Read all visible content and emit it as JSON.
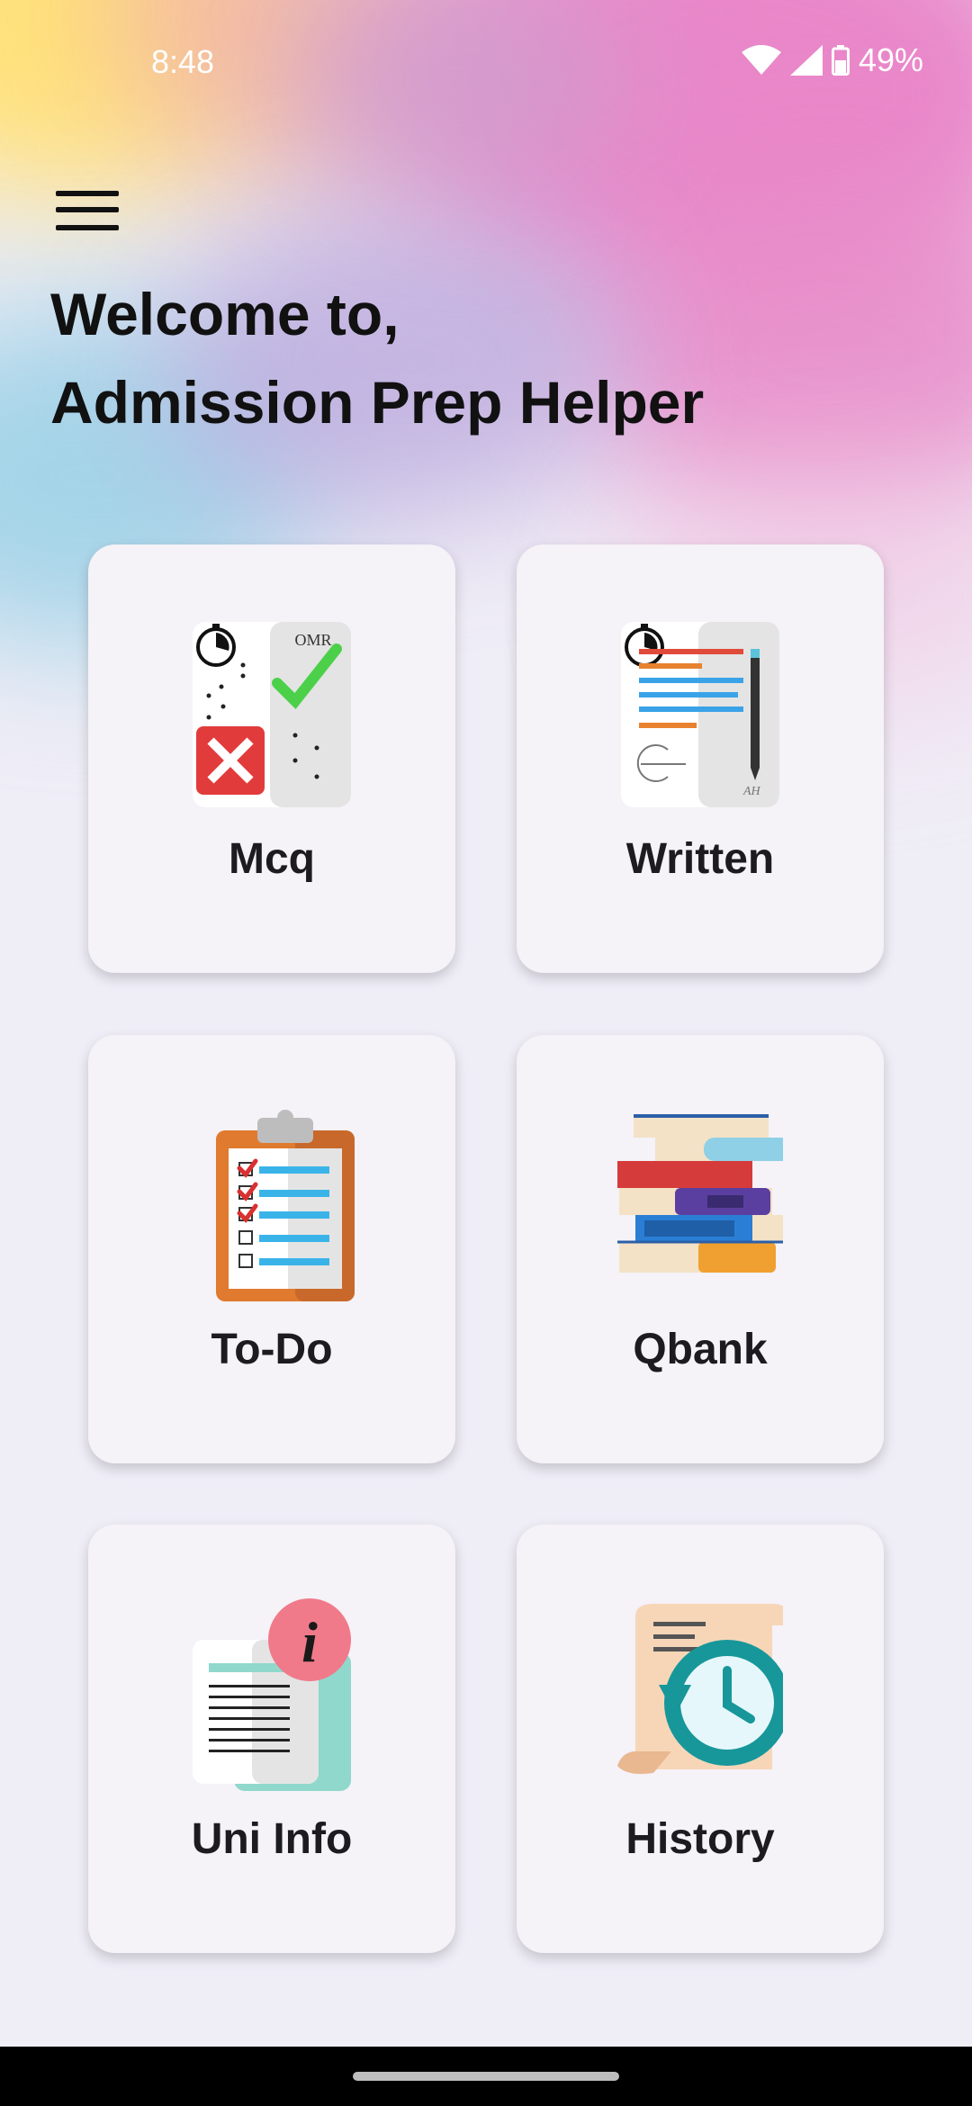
{
  "status_bar": {
    "time": "8:48",
    "battery": "49%"
  },
  "header": {
    "welcome_line1": "Welcome to,",
    "welcome_line2": "Admission Prep Helper"
  },
  "menu": {
    "icon": "hamburger-menu-icon"
  },
  "cards": [
    {
      "label": "Mcq",
      "icon": "omr-sheet-icon",
      "icon_text": "OMR"
    },
    {
      "label": "Written",
      "icon": "written-exam-icon"
    },
    {
      "label": "To-Do",
      "icon": "clipboard-checklist-icon"
    },
    {
      "label": "Qbank",
      "icon": "book-stack-icon"
    },
    {
      "label": "Uni Info",
      "icon": "info-document-icon"
    },
    {
      "label": "History",
      "icon": "history-clock-icon"
    }
  ]
}
